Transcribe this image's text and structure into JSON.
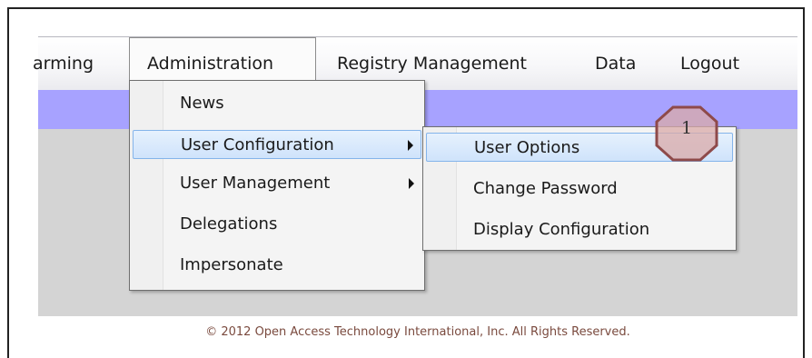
{
  "menubar": {
    "items": [
      {
        "label": "arming"
      },
      {
        "label": "Administration"
      },
      {
        "label": "Registry Management"
      },
      {
        "label": "Data"
      },
      {
        "label": "Logout"
      }
    ]
  },
  "admin_menu": {
    "items": [
      {
        "label": "News"
      },
      {
        "label": "User Configuration"
      },
      {
        "label": "User Management"
      },
      {
        "label": "Delegations"
      },
      {
        "label": "Impersonate"
      }
    ]
  },
  "user_config_menu": {
    "items": [
      {
        "label": "User Options"
      },
      {
        "label": "Change Password"
      },
      {
        "label": "Display Configuration"
      }
    ]
  },
  "callout": {
    "number": "1"
  },
  "footer": {
    "text": "© 2012 Open Access Technology International, Inc. All Rights Reserved."
  },
  "colors": {
    "accent_bar": "#a7a2ff",
    "highlight": "#cfe3fb",
    "callout_fill": "#d9a9a8"
  }
}
